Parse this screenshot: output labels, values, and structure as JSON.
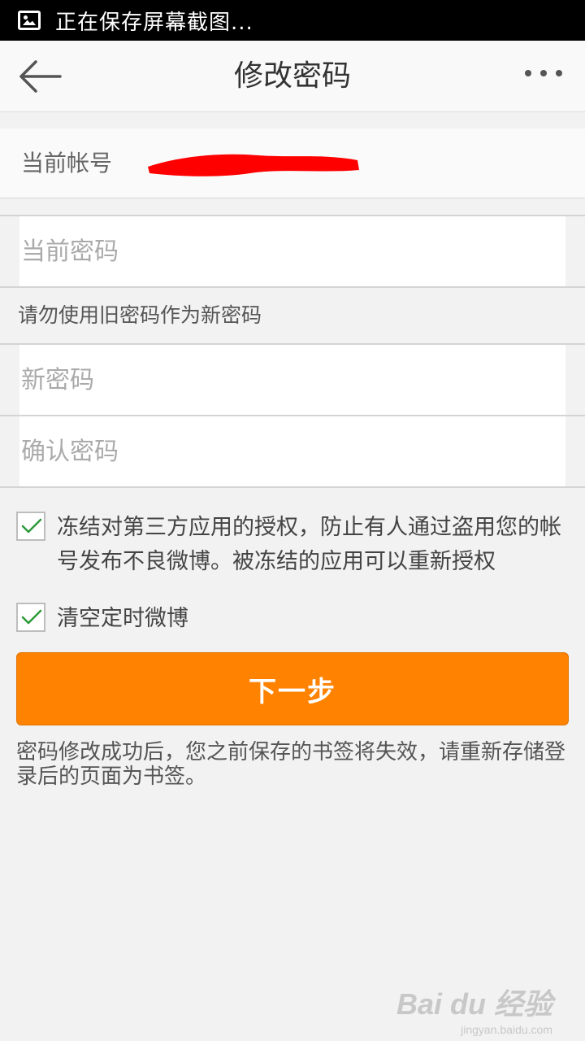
{
  "status_bar": {
    "icon": "image-icon",
    "text": "正在保存屏幕截图..."
  },
  "navbar": {
    "back_icon": "back-arrow-icon",
    "title": "修改密码",
    "more_icon": "more-dots-icon"
  },
  "account": {
    "label": "当前帐号",
    "redaction_color": "#ff0000"
  },
  "form": {
    "current_password_placeholder": "当前密码",
    "hint": "请勿使用旧密码作为新密码",
    "new_password_placeholder": "新密码",
    "confirm_password_placeholder": "确认密码"
  },
  "options": [
    {
      "checked": true,
      "label": "冻结对第三方应用的授权，防止有人通过盗用您的帐号发布不良微博。被冻结的应用可以重新授权"
    },
    {
      "checked": true,
      "label": "清空定时微博"
    }
  ],
  "next_button": {
    "label": "下一步",
    "color": "#ff8200"
  },
  "footnote": "密码修改成功后，您之前保存的书签将失效，请重新存储登录后的页面为书签。",
  "watermark": {
    "main": "Bai du 经验",
    "sub": "jingyan.baidu.com"
  }
}
